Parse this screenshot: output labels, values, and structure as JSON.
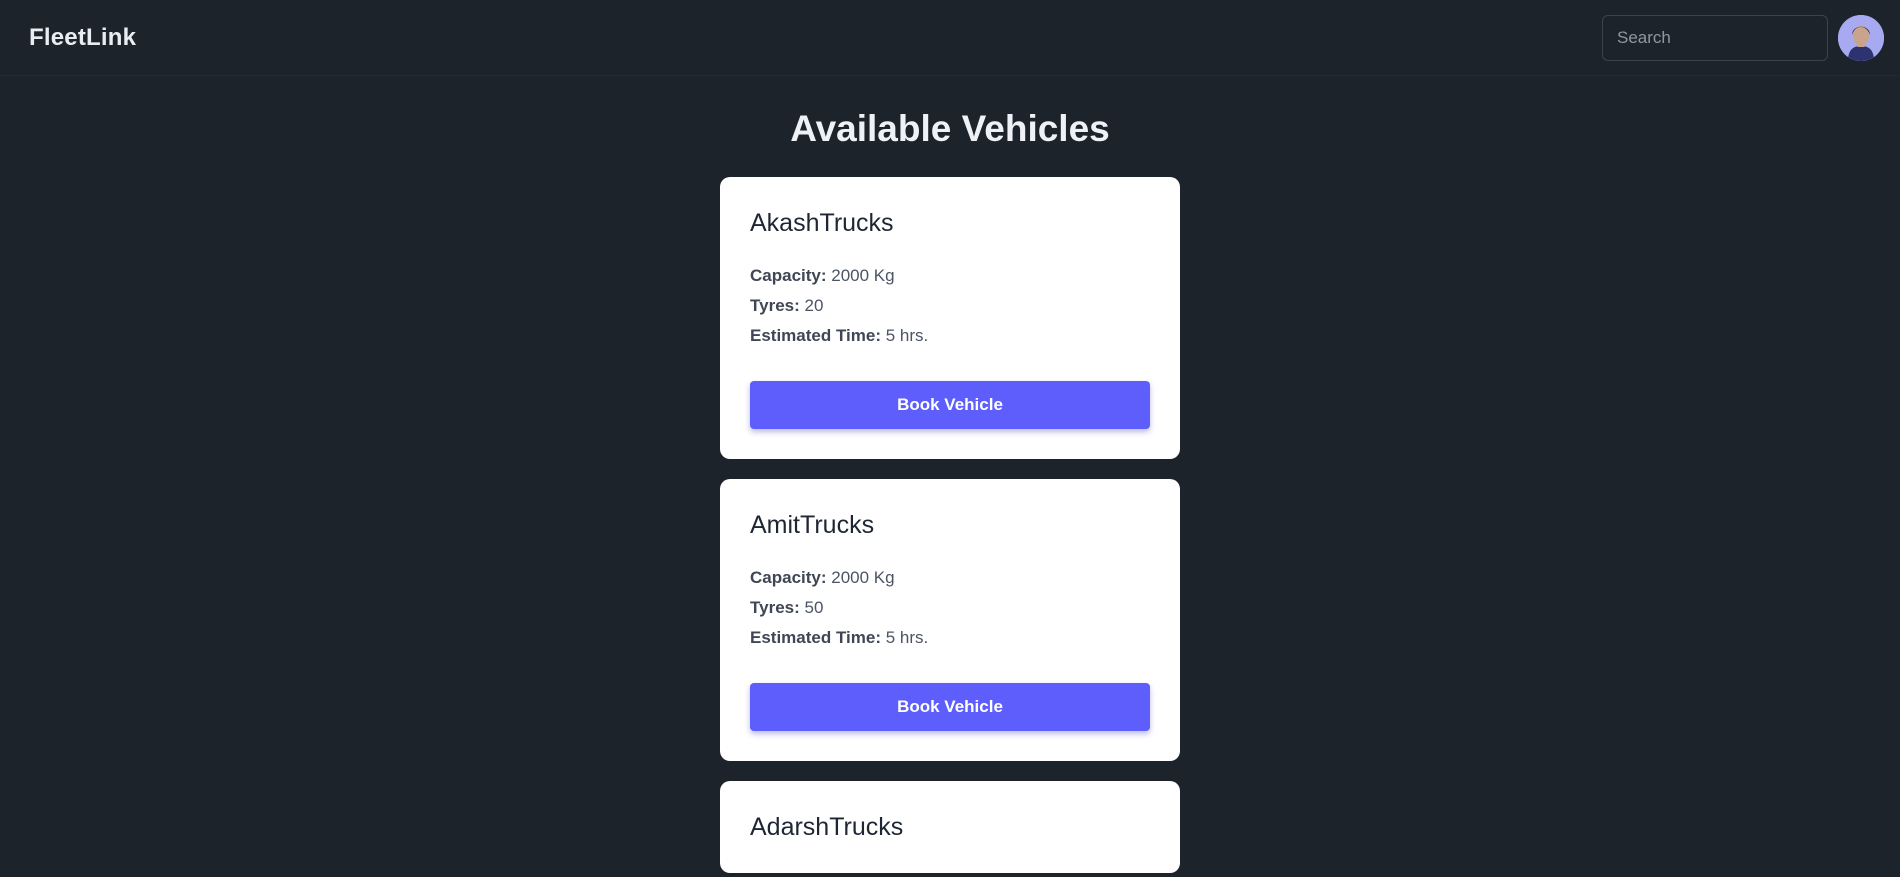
{
  "navbar": {
    "brand": "FleetLink",
    "search_placeholder": "Search"
  },
  "main": {
    "title": "Available Vehicles"
  },
  "vehicles": [
    {
      "name": "AkashTrucks",
      "capacity_label": "Capacity:",
      "capacity_value": "2000 Kg",
      "tyres_label": "Tyres:",
      "tyres_value": "20",
      "time_label": "Estimated Time:",
      "time_value": "5 hrs.",
      "button_label": "Book Vehicle"
    },
    {
      "name": "AmitTrucks",
      "capacity_label": "Capacity:",
      "capacity_value": "2000 Kg",
      "tyres_label": "Tyres:",
      "tyres_value": "50",
      "time_label": "Estimated Time:",
      "time_value": "5 hrs.",
      "button_label": "Book Vehicle"
    },
    {
      "name": "AdarshTrucks"
    }
  ],
  "colors": {
    "background": "#1d232a",
    "card": "#ffffff",
    "accent": "#5d5efb"
  },
  "icons": {
    "avatar": "user-avatar-icon"
  }
}
